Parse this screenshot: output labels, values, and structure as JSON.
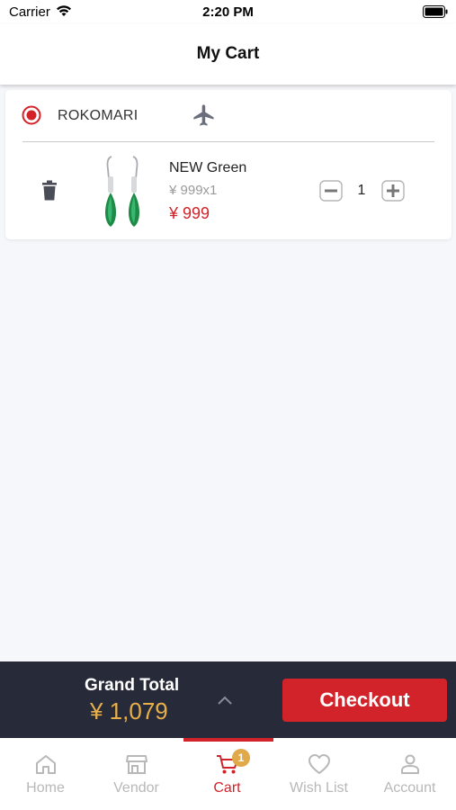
{
  "status_bar": {
    "carrier": "Carrier",
    "time": "2:20 PM"
  },
  "header": {
    "title": "My Cart"
  },
  "cart": {
    "vendor": {
      "name": "ROKOMARI",
      "selected": true,
      "shipping_icon": "plane-icon"
    },
    "items": [
      {
        "name": "NEW Green",
        "unit_price": "¥ 999x1",
        "total": "¥ 999",
        "quantity": "1"
      }
    ]
  },
  "summary": {
    "grand_total_label": "Grand Total",
    "grand_total_value": "¥ 1,079",
    "checkout_label": "Checkout"
  },
  "tab_bar": {
    "active": "Cart",
    "tabs": [
      {
        "label": "Home",
        "icon": "home-icon"
      },
      {
        "label": "Vendor",
        "icon": "store-icon"
      },
      {
        "label": "Cart",
        "icon": "cart-icon",
        "badge": "1"
      },
      {
        "label": "Wish List",
        "icon": "heart-icon"
      },
      {
        "label": "Account",
        "icon": "account-icon"
      }
    ]
  },
  "colors": {
    "accent": "#d2232a",
    "summary_bg": "#272a38",
    "total_gold": "#e8b04a",
    "badge": "#e0a94a",
    "inactive": "#b8b8b8"
  }
}
